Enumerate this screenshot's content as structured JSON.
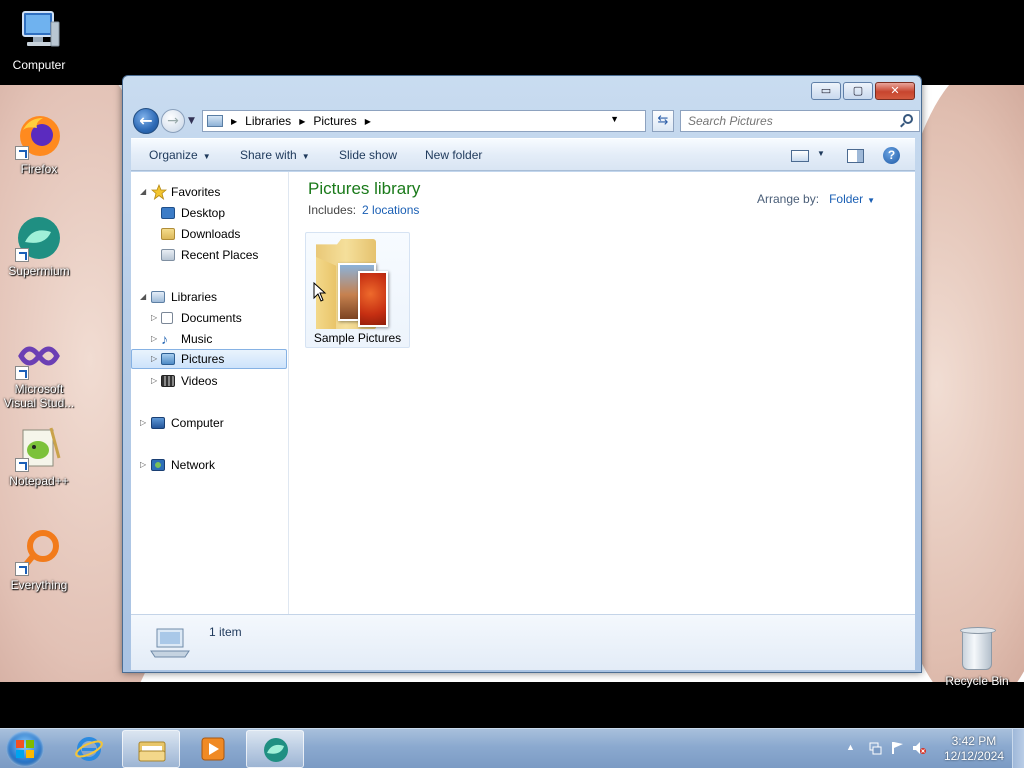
{
  "desktop": {
    "icons": [
      {
        "label": "Computer"
      },
      {
        "label": "Firefox"
      },
      {
        "label": "Supermium"
      },
      {
        "label": "Microsoft Visual Stud..."
      },
      {
        "label": "Notepad++"
      },
      {
        "label": "Everything"
      }
    ],
    "recycle_bin": {
      "label": "Recycle Bin"
    }
  },
  "window": {
    "controls": {
      "minimize": "▭",
      "maximize": "▢",
      "close": "✕"
    },
    "address": {
      "crumbs": [
        "Libraries",
        "Pictures"
      ],
      "search_placeholder": "Search Pictures"
    },
    "toolbar": {
      "organize": "Organize",
      "share_with": "Share with",
      "slide_show": "Slide show",
      "new_folder": "New folder",
      "help": "?"
    },
    "nav": {
      "favorites": "Favorites",
      "desktop": "Desktop",
      "downloads": "Downloads",
      "recent_places": "Recent Places",
      "libraries": "Libraries",
      "documents": "Documents",
      "music": "Music",
      "pictures": "Pictures",
      "videos": "Videos",
      "computer": "Computer",
      "network": "Network"
    },
    "main": {
      "title": "Pictures library",
      "includes_label": "Includes:",
      "includes_link": "2 locations",
      "arrange_label": "Arrange by:",
      "arrange_value": "Folder",
      "items": [
        {
          "name": "Sample Pictures"
        }
      ]
    },
    "details": {
      "count": "1 item"
    }
  },
  "taskbar": {
    "clock_time": "3:42 PM",
    "clock_date": "12/12/2024"
  },
  "colors": {
    "library_title": "#1a7a1a",
    "link": "#1a5fb4",
    "selection": "#cde3fb"
  }
}
